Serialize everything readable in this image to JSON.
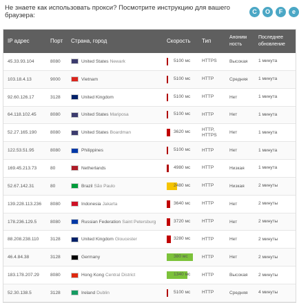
{
  "hint": "Не знаете как использовать прокси? Посмотрите инструкцию для вашего браузера:",
  "browsers": [
    {
      "name": "chrome-icon",
      "glyph": "C"
    },
    {
      "name": "opera-icon",
      "glyph": "O"
    },
    {
      "name": "firefox-icon",
      "glyph": "F"
    },
    {
      "name": "ie-icon",
      "glyph": "e"
    }
  ],
  "headers": {
    "ip": "IP адрес",
    "port": "Порт",
    "country": "Страна, город",
    "speed": "Скорость",
    "type": "Тип",
    "anon": "Аноним ность",
    "updated": "Последнее обновление"
  },
  "rows": [
    {
      "ip": "45.33.93.104",
      "port": "8080",
      "flag": "#3c3b6e",
      "country": "United States",
      "city": "Newark",
      "speed": "5100 мс",
      "speed_fill": 0.05,
      "speed_color": "#b00000",
      "type": "HTTPS",
      "anon": "Высокая",
      "updated": "1 минута"
    },
    {
      "ip": "103.18.4.13",
      "port": "9000",
      "flag": "#da251d",
      "country": "Vietnam",
      "city": "",
      "speed": "5100 мс",
      "speed_fill": 0.05,
      "speed_color": "#b00000",
      "type": "HTTP",
      "anon": "Средняя",
      "updated": "1 минута"
    },
    {
      "ip": "92.60.126.17",
      "port": "3128",
      "flag": "#012169",
      "country": "United Kingdom",
      "city": "",
      "speed": "5100 мс",
      "speed_fill": 0.05,
      "speed_color": "#b00000",
      "type": "HTTP",
      "anon": "Нет",
      "updated": "1 минута"
    },
    {
      "ip": "64.118.102.45",
      "port": "8080",
      "flag": "#3c3b6e",
      "country": "United States",
      "city": "Mariposa",
      "speed": "5100 мс",
      "speed_fill": 0.05,
      "speed_color": "#b00000",
      "type": "HTTP",
      "anon": "Нет",
      "updated": "1 минута"
    },
    {
      "ip": "52.27.165.190",
      "port": "8080",
      "flag": "#3c3b6e",
      "country": "United States",
      "city": "Boardman",
      "speed": "3620 мс",
      "speed_fill": 0.12,
      "speed_color": "#c00000",
      "type": "HTTP, HTTPS",
      "anon": "Нет",
      "updated": "1 минута"
    },
    {
      "ip": "122.53.51.95",
      "port": "8080",
      "flag": "#0038a8",
      "country": "Philippines",
      "city": "",
      "speed": "5100 мс",
      "speed_fill": 0.05,
      "speed_color": "#b00000",
      "type": "HTTP",
      "anon": "Нет",
      "updated": "1 минута"
    },
    {
      "ip": "169.45.213.73",
      "port": "80",
      "flag": "#ae1c28",
      "country": "Netherlands",
      "city": "",
      "speed": "4980 мс",
      "speed_fill": 0.07,
      "speed_color": "#b00000",
      "type": "HTTP",
      "anon": "Низкая",
      "updated": "1 минута"
    },
    {
      "ip": "52.67.142.31",
      "port": "80",
      "flag": "#009c3b",
      "country": "Brazil",
      "city": "São Paulo",
      "speed": "2480 мс",
      "speed_fill": 0.35,
      "speed_color": "#f5c400",
      "type": "HTTP",
      "anon": "Низкая",
      "updated": "2 минуты"
    },
    {
      "ip": "139.228.113.236",
      "port": "8080",
      "flag": "#ce1126",
      "country": "Indonesia",
      "city": "Jakarta",
      "speed": "3640 мс",
      "speed_fill": 0.12,
      "speed_color": "#c00000",
      "type": "HTTP",
      "anon": "Нет",
      "updated": "2 минуты"
    },
    {
      "ip": "178.236.129.5",
      "port": "8080",
      "flag": "#0039a6",
      "country": "Russian Federation",
      "city": "Saint Petersburg",
      "speed": "3720 мс",
      "speed_fill": 0.12,
      "speed_color": "#c00000",
      "type": "HTTP",
      "anon": "Нет",
      "updated": "2 минуты"
    },
    {
      "ip": "88.208.238.110",
      "port": "3128",
      "flag": "#012169",
      "country": "United Kingdom",
      "city": "Gloucester",
      "speed": "3280 мс",
      "speed_fill": 0.14,
      "speed_color": "#c00000",
      "type": "HTTP",
      "anon": "Нет",
      "updated": "2 минуты"
    },
    {
      "ip": "46.4.84.38",
      "port": "3128",
      "flag": "#000000",
      "country": "Germany",
      "city": "",
      "speed": "380 мс",
      "speed_fill": 0.9,
      "speed_color": "#7cc23a",
      "type": "HTTP",
      "anon": "Нет",
      "updated": "2 минуты"
    },
    {
      "ip": "183.178.207.29",
      "port": "8080",
      "flag": "#de2910",
      "country": "Hong Kong",
      "city": "Central District",
      "speed": "1340 мс",
      "speed_fill": 0.72,
      "speed_color": "#7cc23a",
      "type": "HTTP",
      "anon": "Высокая",
      "updated": "2 минуты"
    },
    {
      "ip": "52.30.138.5",
      "port": "3128",
      "flag": "#169b62",
      "country": "Ireland",
      "city": "Dublin",
      "speed": "5100 мс",
      "speed_fill": 0.05,
      "speed_color": "#b00000",
      "type": "HTTP",
      "anon": "Средняя",
      "updated": "4 минуты"
    }
  ]
}
